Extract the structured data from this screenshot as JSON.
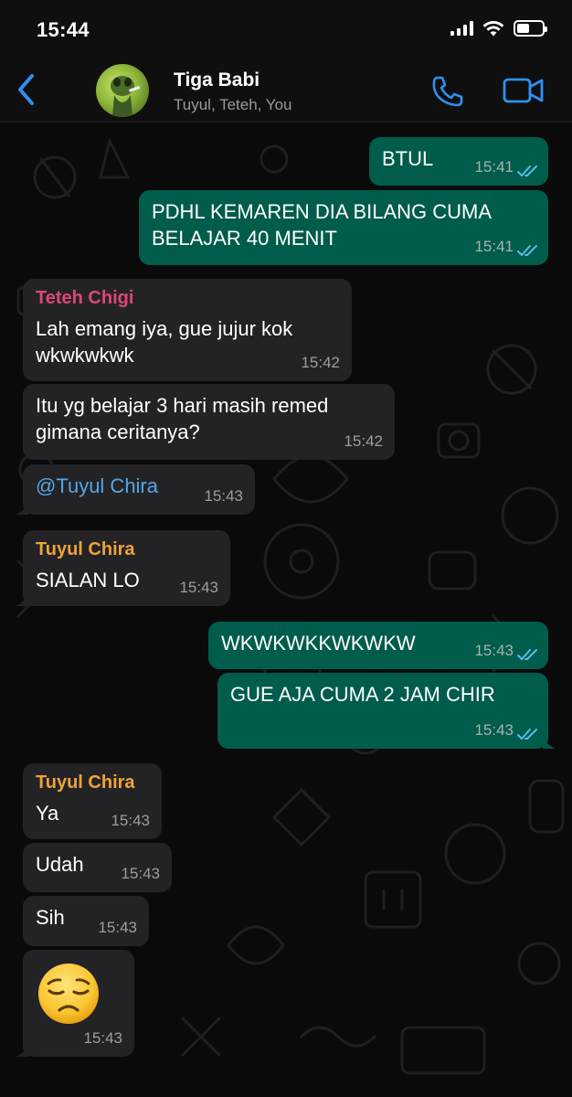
{
  "status_bar": {
    "time": "15:44"
  },
  "header": {
    "title": "Tiga Babi",
    "subtitle": "Tuyul, Teteh, You"
  },
  "colors": {
    "outgoing_bubble": "#005c4b",
    "incoming_bubble": "#232325",
    "accent_blue": "#2f8ff0",
    "sender_teteh": "#e0457b",
    "sender_tuyul": "#f0a23b",
    "read_ticks": "#53bdeb"
  },
  "messages": [
    {
      "direction": "out",
      "text": "BTUL",
      "time": "15:41"
    },
    {
      "direction": "out",
      "text": "PDHL KEMAREN DIA BILANG CUMA",
      "text2": "BELAJAR 40 MENIT",
      "time": "15:41"
    },
    {
      "direction": "in",
      "sender": "Teteh Chigi",
      "text": "Lah emang iya, gue jujur kok",
      "text2": "wkwkwkwk",
      "time": "15:42"
    },
    {
      "direction": "in",
      "text": "Itu yg belajar 3 hari masih remed",
      "text2": "gimana ceritanya?",
      "time": "15:42"
    },
    {
      "direction": "in",
      "text": "@Tuyul Chira",
      "time": "15:43"
    },
    {
      "direction": "in",
      "sender": "Tuyul Chira",
      "text": "SIALAN LO",
      "time": "15:43"
    },
    {
      "direction": "out",
      "text": "WKWKWKKWKWKW",
      "time": "15:43"
    },
    {
      "direction": "out",
      "text": "GUE AJA CUMA 2 JAM CHIR",
      "time": "15:43"
    },
    {
      "direction": "in",
      "sender": "Tuyul Chira",
      "text": "Ya",
      "time": "15:43"
    },
    {
      "direction": "in",
      "text": "Udah",
      "time": "15:43"
    },
    {
      "direction": "in",
      "text": "Sih",
      "time": "15:43"
    },
    {
      "direction": "in",
      "emoji": "disappointed-face",
      "time": "15:43"
    }
  ]
}
